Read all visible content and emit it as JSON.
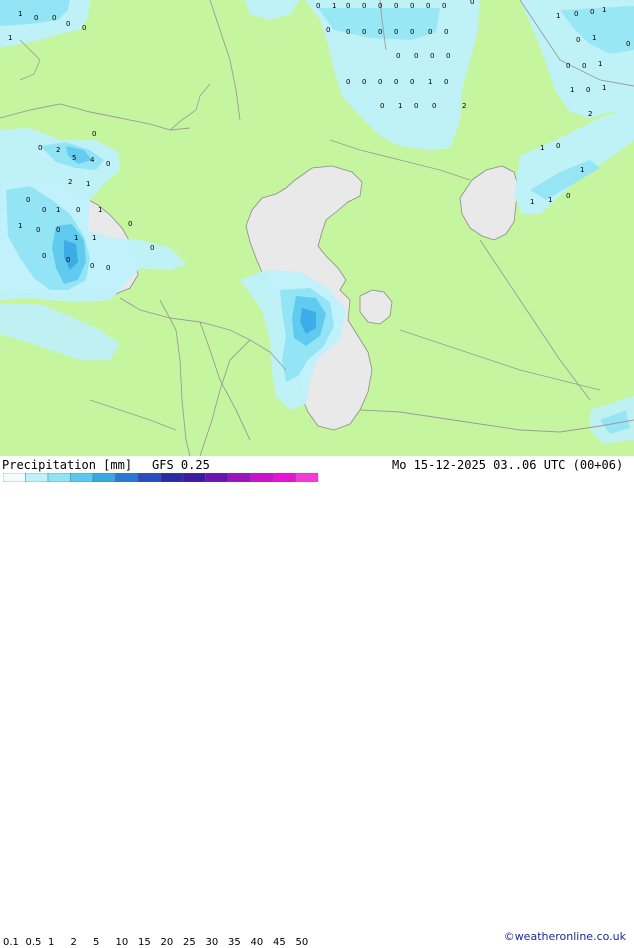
{
  "footer": {
    "title": "Precipitation [mm]",
    "model": "GFS 0.25",
    "datetime": "Mo 15-12-2025 03..06 UTC (00+06)",
    "credit": "©weatheronline.co.uk"
  },
  "legend": {
    "ticks": [
      "0.1",
      "0.5",
      "1",
      "2",
      "5",
      "10",
      "15",
      "20",
      "25",
      "30",
      "35",
      "40",
      "45",
      "50"
    ],
    "colors": [
      "#f0fcfe",
      "#bff1fb",
      "#8ee3f5",
      "#5cc8ee",
      "#38a7e4",
      "#2a78d4",
      "#2c4bbd",
      "#2a2aa4",
      "#3d1aa3",
      "#6a14b2",
      "#9914bd",
      "#c814c8",
      "#e414d4",
      "#f23cd6"
    ]
  },
  "map_colors": {
    "land": "#c6f5a0",
    "water": "#e9e9e9",
    "border": "#9b9b9b",
    "coast": "#8a8a8a",
    "precip_light": "#bff1fb",
    "precip_mid": "#8ee3f5",
    "precip_heavy": "#5cc8ee",
    "precip_max": "#38a7e4"
  },
  "map_labels": [
    "0",
    "1",
    "0",
    "0",
    "0",
    "0",
    "0",
    "0",
    "0",
    "0",
    "1",
    "0",
    "0",
    "0",
    "0",
    "1",
    "0",
    "0",
    "0",
    "0",
    "0",
    "0",
    "0",
    "0",
    "0",
    "0",
    "0",
    "0",
    "0",
    "0",
    "0",
    "0",
    "0",
    "1",
    "0",
    "0",
    "1",
    "0",
    "0",
    "2",
    "1",
    "0",
    "0",
    "1",
    "0",
    "1",
    "0",
    "0",
    "0",
    "1",
    "1",
    "0",
    "1",
    "2",
    "1",
    "0",
    "1",
    "1",
    "1",
    "0",
    "0",
    "0",
    "2",
    "5",
    "4",
    "0",
    "2",
    "1",
    "0",
    "0",
    "1",
    "0",
    "1",
    "1",
    "0",
    "0",
    "1",
    "1",
    "0",
    "0",
    "0",
    "0",
    "0",
    "0"
  ]
}
